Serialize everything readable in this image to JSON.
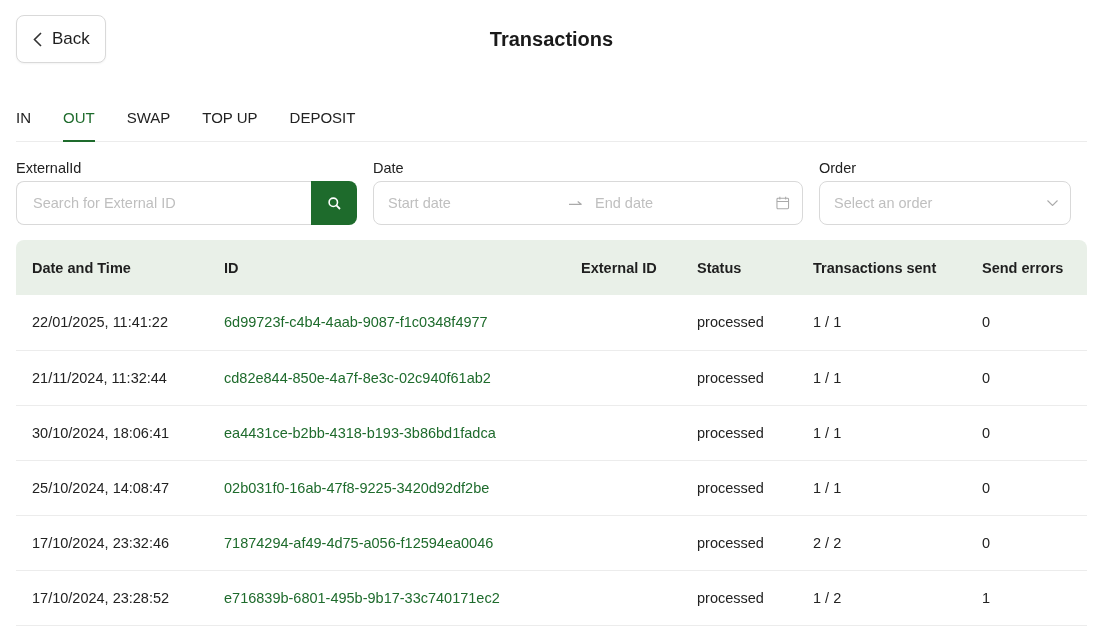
{
  "header": {
    "back_label": "Back",
    "title": "Transactions"
  },
  "tabs": [
    {
      "label": "IN",
      "selected": false
    },
    {
      "label": "OUT",
      "selected": true
    },
    {
      "label": "SWAP",
      "selected": false
    },
    {
      "label": "TOP UP",
      "selected": false
    },
    {
      "label": "DEPOSIT",
      "selected": false
    }
  ],
  "filters": {
    "external_id": {
      "label": "ExternalId",
      "placeholder": "Search for External ID"
    },
    "date": {
      "label": "Date",
      "start_placeholder": "Start date",
      "end_placeholder": "End date"
    },
    "order": {
      "label": "Order",
      "placeholder": "Select an order"
    }
  },
  "table": {
    "columns": [
      "Date and Time",
      "ID",
      "External ID",
      "Status",
      "Transactions sent",
      "Send errors"
    ],
    "rows": [
      {
        "date_time": "22/01/2025, 11:41:22",
        "id": "6d99723f-c4b4-4aab-9087-f1c0348f4977",
        "status": "processed",
        "transactions_sent": "1 / 1",
        "send_errors": "0"
      },
      {
        "date_time": "21/11/2024, 11:32:44",
        "id": "cd82e844-850e-4a7f-8e3c-02c940f61ab2",
        "status": "processed",
        "transactions_sent": "1 / 1",
        "send_errors": "0"
      },
      {
        "date_time": "30/10/2024, 18:06:41",
        "id": "ea4431ce-b2bb-4318-b193-3b86bd1fadca",
        "status": "processed",
        "transactions_sent": "1 / 1",
        "send_errors": "0"
      },
      {
        "date_time": "25/10/2024, 14:08:47",
        "id": "02b031f0-16ab-47f8-9225-3420d92df2be",
        "status": "processed",
        "transactions_sent": "1 / 1",
        "send_errors": "0"
      },
      {
        "date_time": "17/10/2024, 23:32:46",
        "id": "71874294-af49-4d75-a056-f12594ea0046",
        "status": "processed",
        "transactions_sent": "2 / 2",
        "send_errors": "0"
      },
      {
        "date_time": "17/10/2024, 23:28:52",
        "id": "e716839b-6801-495b-9b17-33c740171ec2",
        "status": "processed",
        "transactions_sent": "1 / 2",
        "send_errors": "1"
      }
    ]
  }
}
